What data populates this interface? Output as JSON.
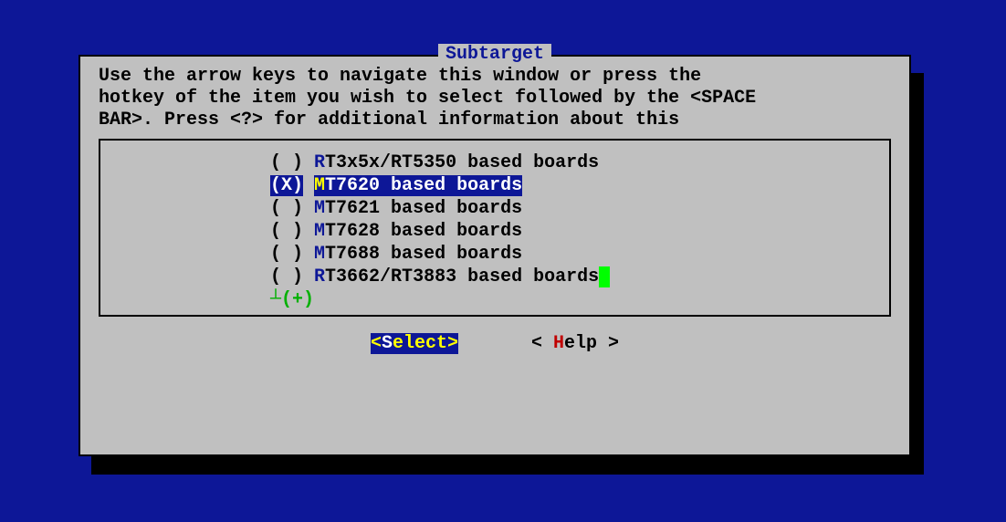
{
  "title": "Subtarget",
  "help_text": "Use the arrow keys to navigate this window or press the\nhotkey of the item you wish to select followed by the <SPACE\nBAR>. Press <?> for additional information about this",
  "options": [
    {
      "radio": "( )",
      "hotkey": "R",
      "rest": "T3x5x/RT5350 based boards",
      "selected": false
    },
    {
      "radio": "(X)",
      "hotkey": "M",
      "rest": "T7620 based boards",
      "selected": true
    },
    {
      "radio": "( )",
      "hotkey": "M",
      "rest": "T7621 based boards",
      "selected": false
    },
    {
      "radio": "( )",
      "hotkey": "M",
      "rest": "T7628 based boards",
      "selected": false
    },
    {
      "radio": "( )",
      "hotkey": "M",
      "rest": "T7688 based boards",
      "selected": false
    },
    {
      "radio": "( )",
      "hotkey": "R",
      "rest": "T3662/RT3883 based boards",
      "selected": false
    }
  ],
  "more_indicator": "┴(+)",
  "buttons": {
    "select": {
      "brackets_open": "<",
      "letter": "S",
      "rest": "elect",
      "brackets_close": ">"
    },
    "help": {
      "brackets_open": "< ",
      "letter": "H",
      "rest": "elp",
      "brackets_close": " >"
    }
  },
  "cursor": " "
}
